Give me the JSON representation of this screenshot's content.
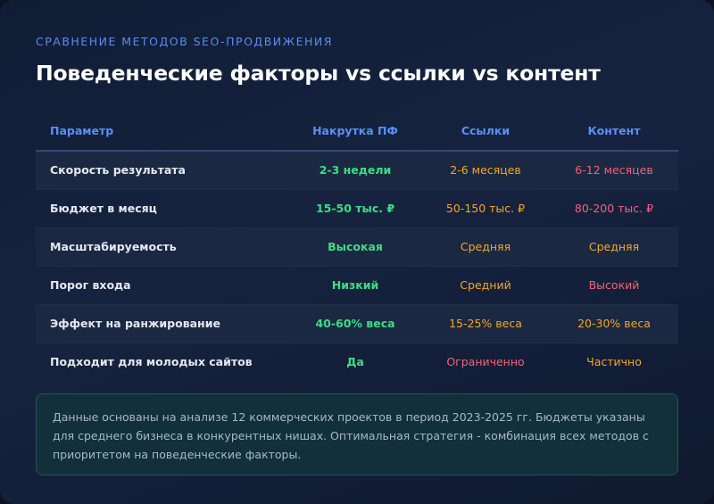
{
  "header": {
    "subtitle": "СРАВНЕНИЕ МЕТОДОВ SEO-ПРОДВИЖЕНИЯ",
    "title": "Поведенческие факторы vs ссылки vs контент"
  },
  "table": {
    "columns": [
      "Параметр",
      "Накрутка ПФ",
      "Ссылки",
      "Контент"
    ],
    "rows": [
      [
        "Скорость результата",
        "2-3 недели",
        "2-6 месяцев",
        "6-12 месяцев"
      ],
      [
        "Бюджет в месяц",
        "15-50 тыс. ₽",
        "50-150 тыс. ₽",
        "80-200 тыс. ₽"
      ],
      [
        "Масштабируемость",
        "Высокая",
        "Средняя",
        "Средняя"
      ],
      [
        "Порог входа",
        "Низкий",
        "Средний",
        "Высокий"
      ],
      [
        "Эффект на ранжирование",
        "40-60% веса",
        "15-25% веса",
        "20-30% веса"
      ],
      [
        "Подходит для молодых сайтов",
        "Да",
        "Ограниченно",
        "Частично"
      ]
    ]
  },
  "note": {
    "text": "Данные основаны на анализе 12 коммерческих проектов в период 2023-2025 гг. Бюджеты указаны для среднего бизнеса в конкурентных нишах. Оптимальная стратегия - комбинация всех методов с приоритетом на поведенческие факторы."
  },
  "colors": {
    "accent": "#5b8ff5",
    "positive": "#3ddc84",
    "neutral": "#f5a623",
    "negative": "#f2617a"
  }
}
